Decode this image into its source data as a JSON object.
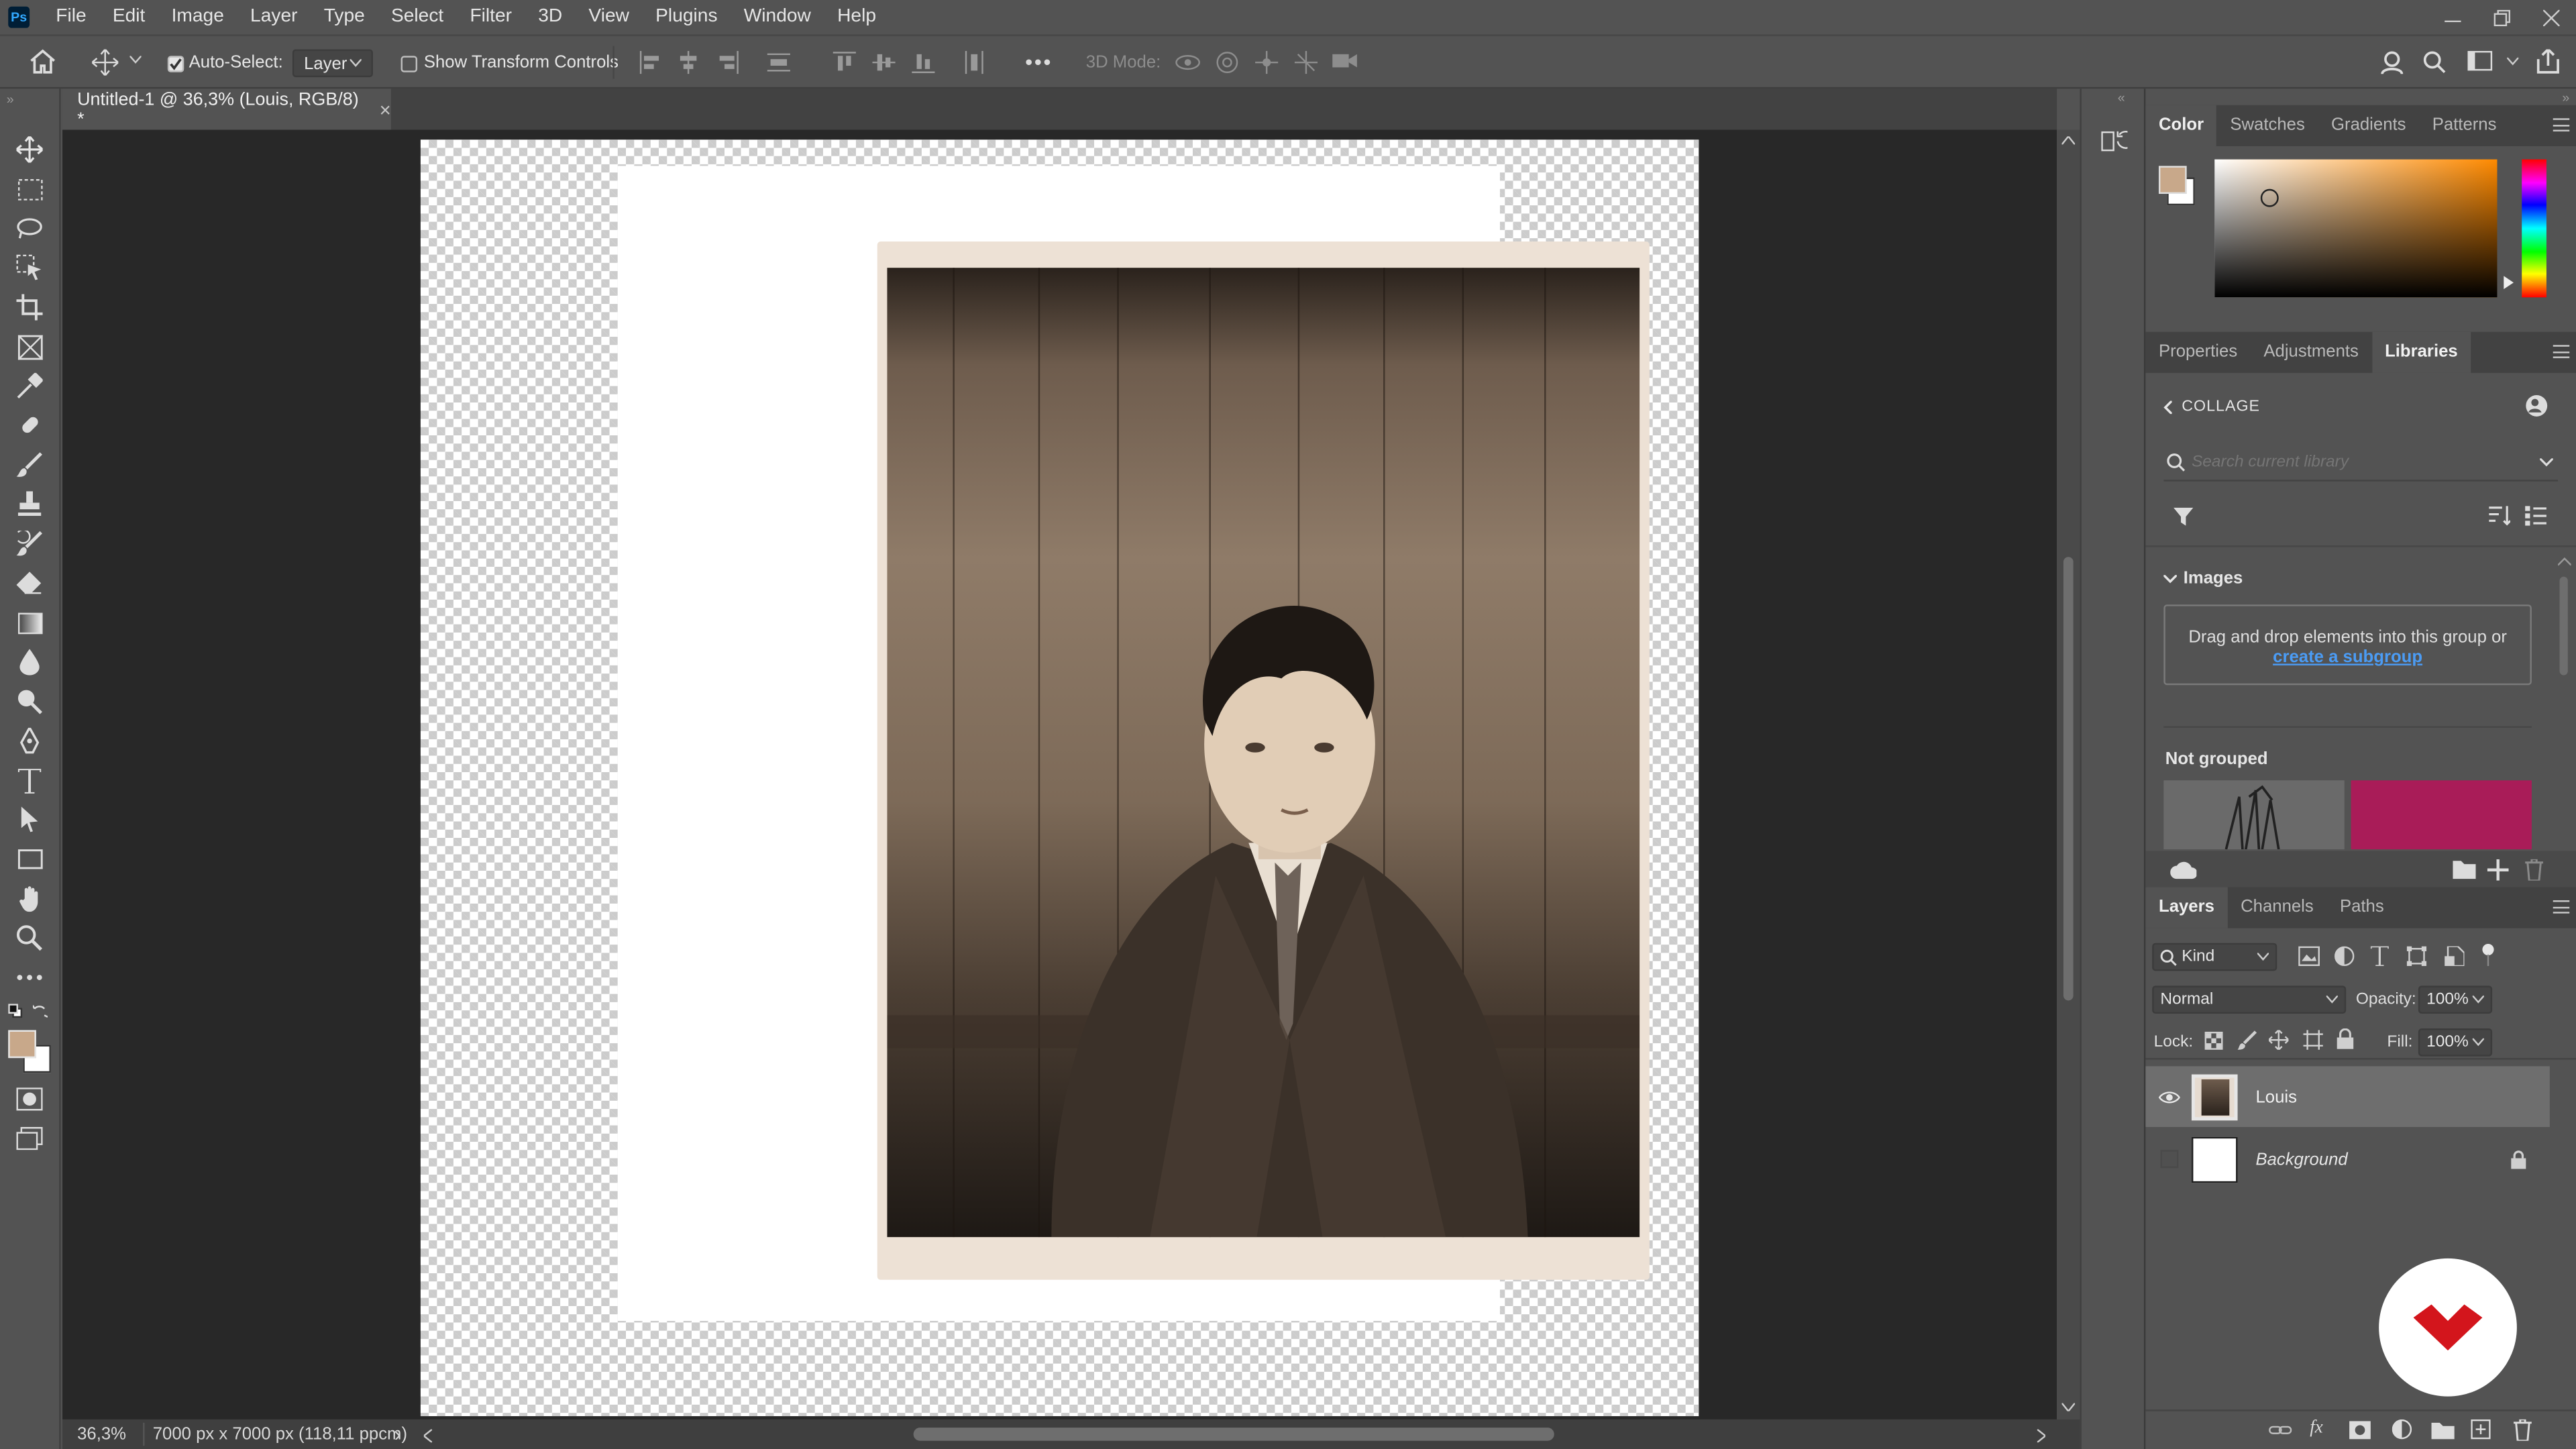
{
  "menubar": {
    "app_icon": "Ps",
    "items": [
      "File",
      "Edit",
      "Image",
      "Layer",
      "Type",
      "Select",
      "Filter",
      "3D",
      "View",
      "Plugins",
      "Window",
      "Help"
    ]
  },
  "options": {
    "auto_select_label": "Auto-Select:",
    "auto_select_checked": true,
    "target_value": "Layer",
    "show_transform_label": "Show Transform Controls",
    "mode3d_label": "3D Mode:",
    "more": "•••"
  },
  "document": {
    "tab_title": "Untitled-1 @ 36,3% (Louis, RGB/8) *",
    "tab_close": "×"
  },
  "status": {
    "zoom": "36,3%",
    "doc_info": "7000 px x 7000 px (118,11 ppcm)",
    "arrow": "›"
  },
  "color_panel": {
    "tabs": [
      "Color",
      "Swatches",
      "Gradients",
      "Patterns"
    ],
    "active": "Color",
    "foreground": "#c8a88a",
    "background": "#ffffff"
  },
  "properties_panel": {
    "tabs": [
      "Properties",
      "Adjustments",
      "Libraries"
    ],
    "active": "Libraries",
    "library_name": "COLLAGE",
    "search_placeholder": "Search current library",
    "images_section": "Images",
    "drop_hint": "Drag and drop elements into this group or",
    "drop_link": "create a subgroup",
    "not_grouped": "Not grouped",
    "swatch_color": "#a91c58"
  },
  "layers_panel": {
    "tabs": [
      "Layers",
      "Channels",
      "Paths"
    ],
    "active": "Layers",
    "kind_label": "Kind",
    "blend_mode": "Normal",
    "opacity_label": "Opacity:",
    "opacity_value": "100%",
    "lock_label": "Lock:",
    "fill_label": "Fill:",
    "fill_value": "100%",
    "layers": [
      {
        "name": "Louis",
        "visible": true,
        "selected": true
      },
      {
        "name": "Background",
        "visible": false,
        "locked": true
      }
    ]
  }
}
